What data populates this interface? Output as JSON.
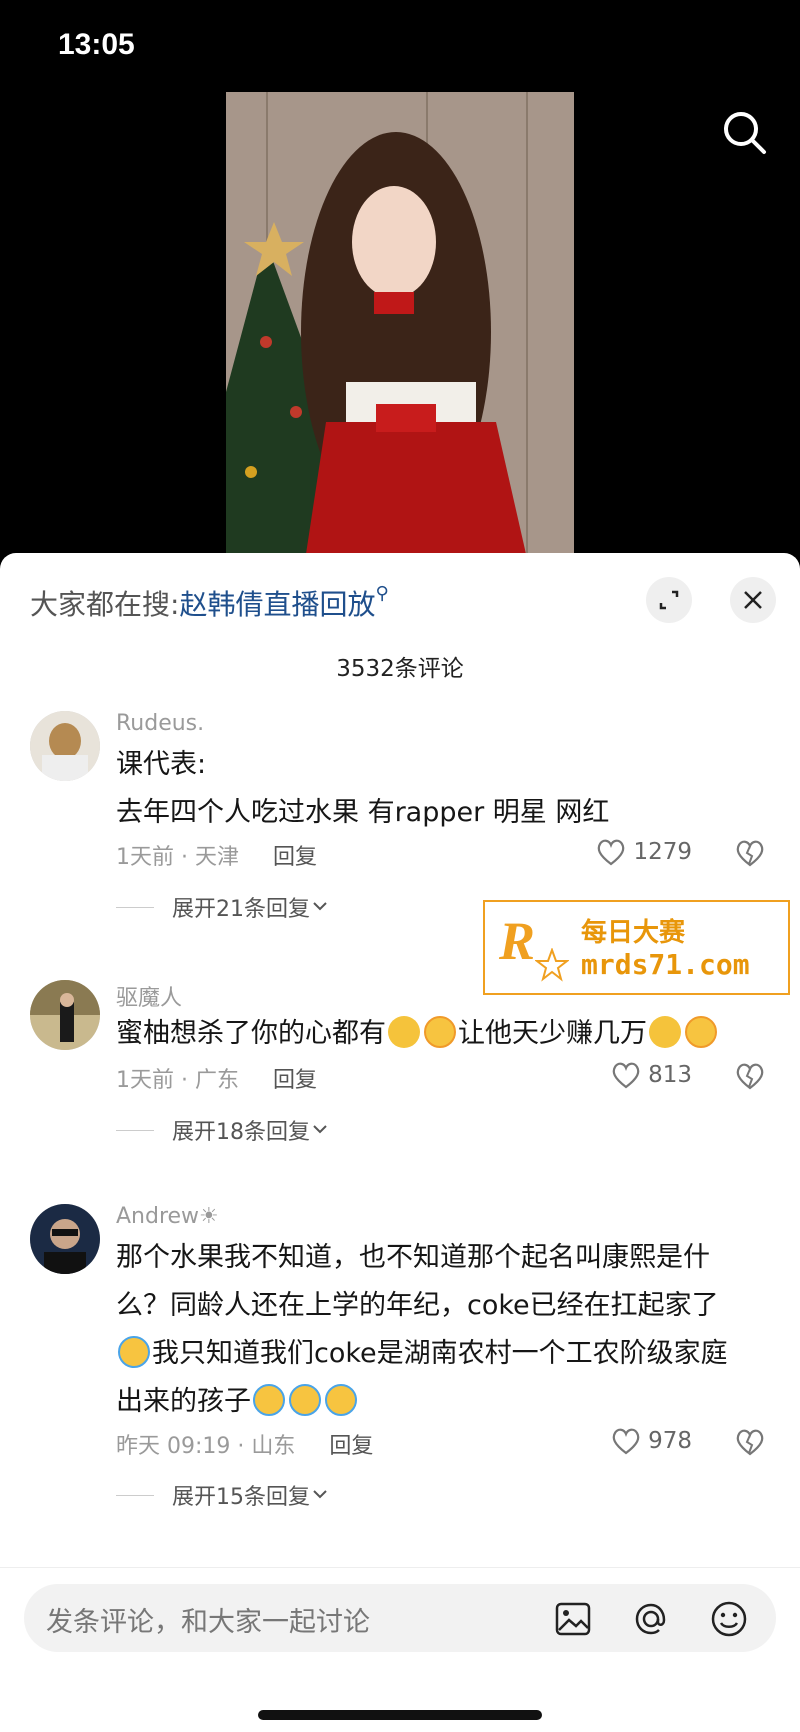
{
  "status": {
    "time": "13:05"
  },
  "hot_search": {
    "label": "大家都在搜:",
    "keyword": "赵韩倩直播回放"
  },
  "comments_count": "3532条评论",
  "comments": [
    {
      "user": "Rudeus.",
      "lines": [
        "课代表:",
        "去年四个人吃过水果 有rapper 明星 网红"
      ],
      "time_location": "1天前 · 天津",
      "reply": "回复",
      "likes": "1279",
      "expand": "展开21条回复"
    },
    {
      "user": "驱魔人",
      "text_a": "蜜柚想杀了你的心都有",
      "text_b": "让他天少赚几万",
      "time_location": "1天前 · 广东",
      "reply": "回复",
      "likes": "813",
      "expand": "展开18条回复"
    },
    {
      "user": "Andrew☀",
      "line1": "那个水果我不知道，也不知道那个起名叫康熙是什",
      "line2": "么？同龄人还在上学的年纪，coke已经在扛起家了",
      "line3": "我只知道我们coke是湖南农村一个工农阶级家庭",
      "line4": "出来的孩子",
      "time_location": "昨天 09:19 · 山东",
      "reply": "回复",
      "likes": "978",
      "expand": "展开15条回复"
    }
  ],
  "watermark": {
    "logo": "R",
    "title": "每日大赛",
    "url": "mrds71.com"
  },
  "input": {
    "placeholder": "发条评论，和大家一起讨论"
  },
  "icons": {
    "search": "search-icon",
    "expand": "expand-icon",
    "close": "close-icon",
    "heart": "heart-icon",
    "dislike": "broken-heart-icon",
    "image": "image-icon",
    "at": "at-icon",
    "emoji": "emoji-icon"
  }
}
